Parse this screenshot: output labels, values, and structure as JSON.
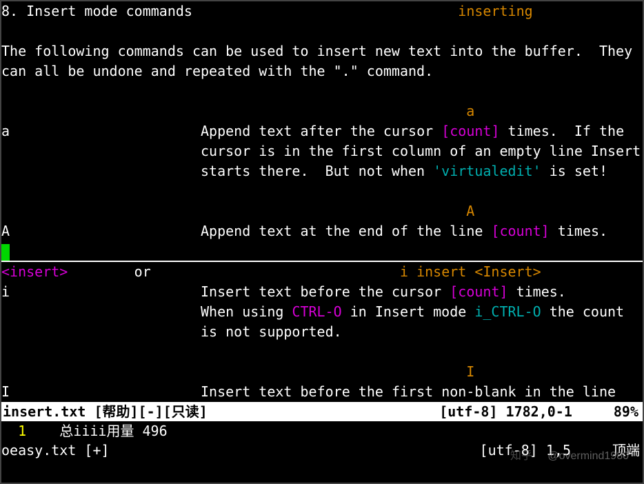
{
  "header": {
    "section_num": "8.",
    "section_title": "Insert mode commands",
    "tag": "inserting"
  },
  "intro_l1": "The following commands can be used to insert new text into the buffer.  They",
  "intro_l2": "can all be undone and repeated with the \".\" command.",
  "cmds": {
    "a": {
      "tag": "a",
      "key": "a",
      "l1a": "Append text after the cursor ",
      "count": "[count]",
      "l1b": " times.  If the",
      "l2": "cursor is in the first column of an empty line Insert",
      "l3a": "starts there.  But not when ",
      "opt": "'virtualedit'",
      "l3b": " is set!"
    },
    "A": {
      "tag": "A",
      "key": "A",
      "l1a": "Append text at the end of the line ",
      "count": "[count]",
      "l1b": " times."
    },
    "i": {
      "insert_tag": "<insert>",
      "or": "or",
      "tags": "i insert <Insert>",
      "key": "i",
      "l1a": "Insert text before the cursor ",
      "count": "[count]",
      "l1b": " times.",
      "l2a": "When using ",
      "ctrl": "CTRL-O",
      "l2b": " in Insert mode ",
      "ictrl": "i_CTRL-O",
      "l2c": " the count",
      "l3": "is not supported."
    },
    "I": {
      "tag": "I",
      "key": "I",
      "l1": "Insert text before the first non-blank in the line"
    }
  },
  "status_help": {
    "filename": "insert.txt",
    "flags": " [帮助][-][只读]",
    "encoding": "[utf-8]",
    "position": "1782,0-1",
    "percent": "89%"
  },
  "bufline": {
    "lineno": "  1 ",
    "text": "   总iiii用量 496"
  },
  "status_buf": {
    "filename": "oeasy.txt",
    "flags": " [+]",
    "encoding": "[utf-8]",
    "position": "1,5",
    "percent": "顶端"
  },
  "watermark": {
    "zhihu": "知乎",
    "user": "@overmind1980"
  }
}
